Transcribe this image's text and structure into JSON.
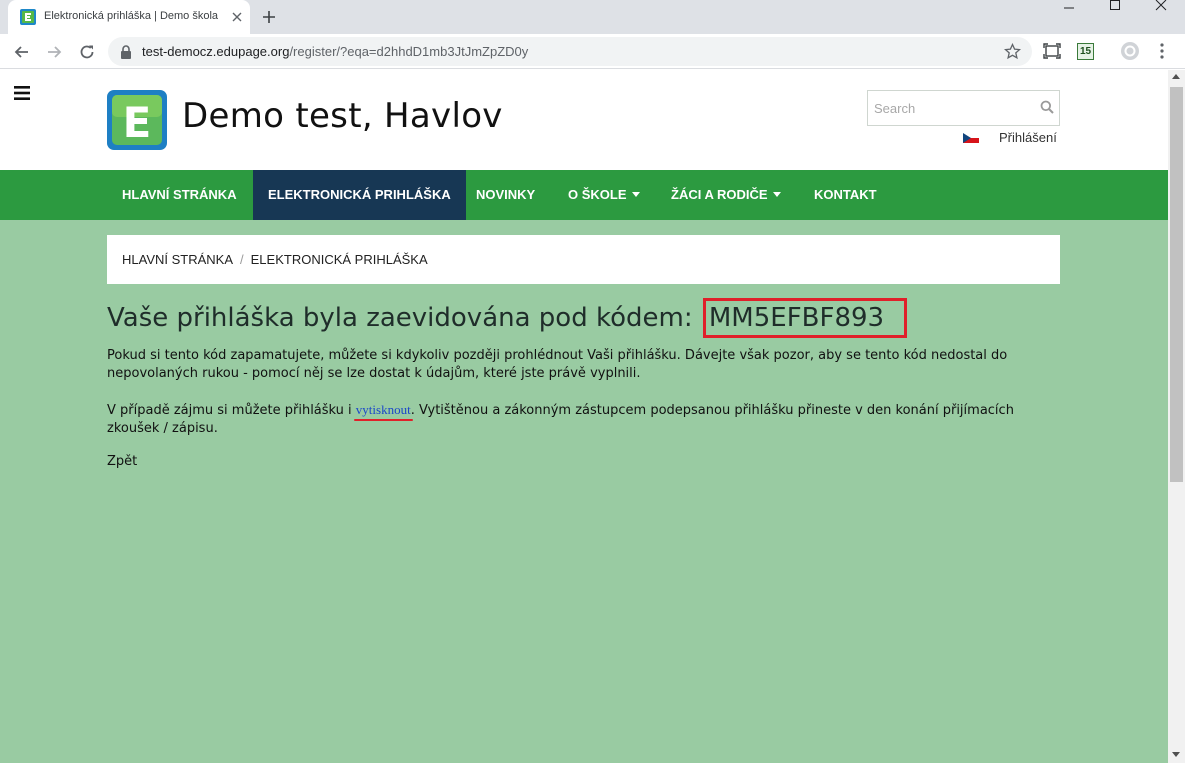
{
  "browser": {
    "tab_title": "Elektronická prihláška | Demo škola",
    "url_host": "test-democz.edupage.org",
    "url_path": "/register/?eqa=d2hhdD1mb3JtJmZpZD0y",
    "extension_badge": "15"
  },
  "site": {
    "logo_letter": "E",
    "title": "Demo test, Havlov",
    "search_placeholder": "Search",
    "login_label": "Přihlášení"
  },
  "nav": {
    "items": [
      {
        "label": "HLAVNÍ STRÁNKA"
      },
      {
        "label": "ELEKTRONICKÁ PRIHLÁŠKA"
      },
      {
        "label": "NOVINKY"
      },
      {
        "label": "O ŠKOLE"
      },
      {
        "label": "ŽÁCI A RODIČE"
      },
      {
        "label": "KONTAKT"
      }
    ]
  },
  "breadcrumb": {
    "home": "HLAVNÍ STRÁNKA",
    "separator": "/",
    "current": "ELEKTRONICKÁ PRIHLÁŠKA"
  },
  "main": {
    "heading_prefix": "Vaše přihláška byla zaevidována pod kódem:",
    "code": "MM5EFBF893",
    "para1": "Pokud si tento kód zapamatujete, můžete si kdykoliv později prohlédnout Vaši přihlášku. Dávejte však pozor, aby se tento kód nedostal do nepovolaných rukou - pomocí něj se lze dostat k údajům, které jste právě vyplnili.",
    "para2_before": "V případě zájmu si můžete přihlášku i ",
    "print_link": "vytisknout",
    "para2_after": ". Vytištěnou a zákonným zástupcem podepsanou přihlášku přineste v den konání přijímacích zkoušek / zápisu.",
    "back_label": "Zpět"
  },
  "colors": {
    "nav_bg": "#2c9a40",
    "nav_active_bg": "#173754",
    "page_bg": "#99cba2",
    "highlight": "#e0202a",
    "link": "#1a47c9"
  }
}
